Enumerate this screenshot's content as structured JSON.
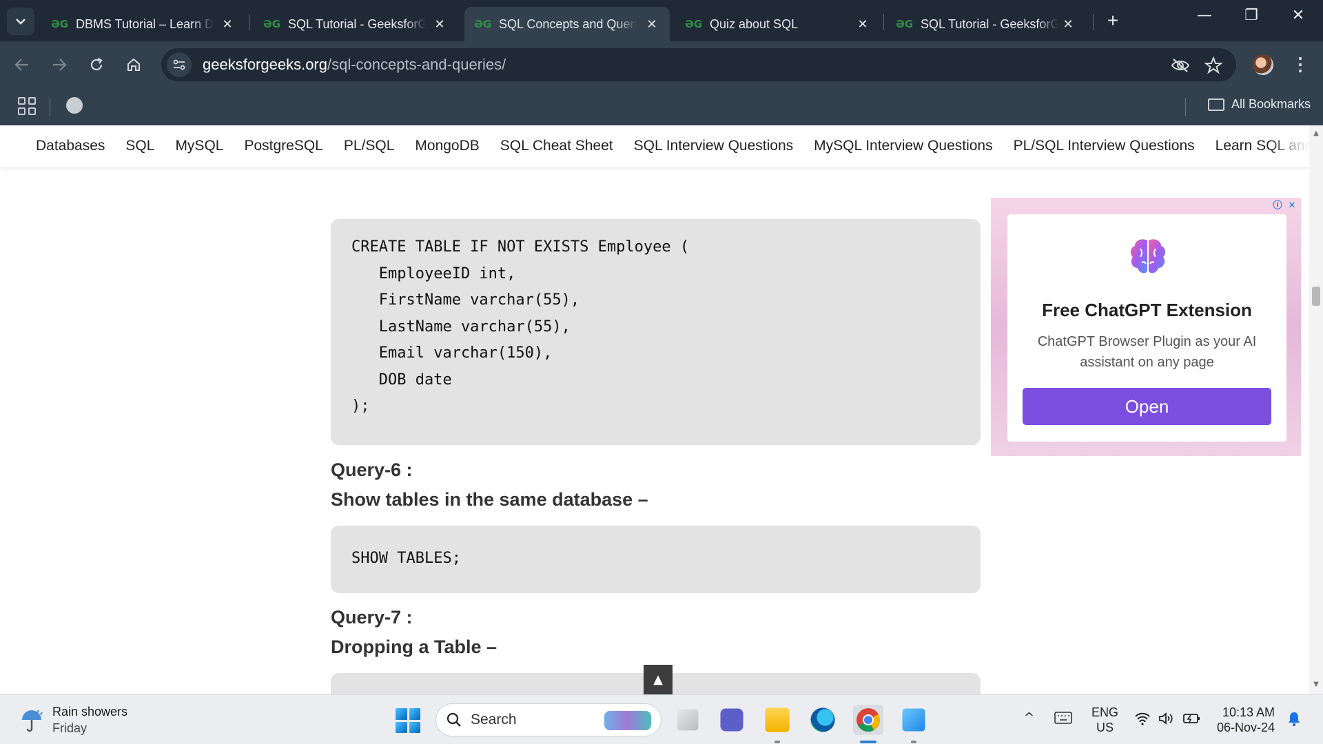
{
  "browser": {
    "tabs": [
      {
        "title": "DBMS Tutorial – Learn Da",
        "favicon": "gfg-logo-icon",
        "active": false
      },
      {
        "title": "SQL Tutorial - GeeksforG",
        "favicon": "gfg-logo-icon",
        "active": false
      },
      {
        "title": "SQL Concepts and Querie",
        "favicon": "gfg-logo-icon",
        "active": true
      },
      {
        "title": "Quiz about SQL",
        "favicon": "gfg-logo-icon",
        "active": false
      },
      {
        "title": "SQL Tutorial - GeeksforG",
        "favicon": "gfg-logo-icon",
        "active": false
      }
    ],
    "favicon_text": "ƏG",
    "close_glyph": "✕",
    "new_tab_glyph": "+",
    "url_host": "geeksforgeeks.org",
    "url_path": "/sql-concepts-and-queries/",
    "all_bookmarks": "All Bookmarks",
    "window_controls": {
      "minimize": "—",
      "restore": "❐",
      "close": "✕"
    }
  },
  "site_nav": {
    "items": [
      "Databases",
      "SQL",
      "MySQL",
      "PostgreSQL",
      "PL/SQL",
      "MongoDB",
      "SQL Cheat Sheet",
      "SQL Interview Questions",
      "MySQL Interview Questions",
      "PL/SQL Interview Questions",
      "Learn SQL and Data"
    ]
  },
  "content": {
    "code_create": [
      "CREATE TABLE IF NOT EXISTS Employee (",
      "   EmployeeID int,",
      "   FirstName varchar(55),",
      "   LastName varchar(55),",
      "   Email varchar(150),",
      "   DOB date",
      ");"
    ],
    "query6_title": "Query-6 :",
    "query6_desc": "Show tables in the same database –",
    "code_show": "SHOW TABLES;",
    "query7_title": "Query-7 :",
    "query7_desc": "Dropping a Table –",
    "back_to_top": "▲"
  },
  "ad": {
    "title": "Free ChatGPT Extension",
    "description": "ChatGPT Browser Plugin as your AI assistant on any page",
    "button": "Open",
    "info_glyph": "ⓘ",
    "close_glyph": "✕",
    "button_color": "#7b4ee0"
  },
  "taskbar": {
    "weather_title": "Rain showers",
    "weather_sub": "Friday",
    "search_label": "Search",
    "lang_top": "ENG",
    "lang_bottom": "US",
    "time": "10:13 AM",
    "date": "06-Nov-24",
    "tray_chevron": "^"
  },
  "colors": {
    "chrome_dark": "#1f2a36",
    "chrome_toolbar": "#33414e",
    "gfg_green": "#2f8d46",
    "code_bg": "#e3e3e3"
  }
}
